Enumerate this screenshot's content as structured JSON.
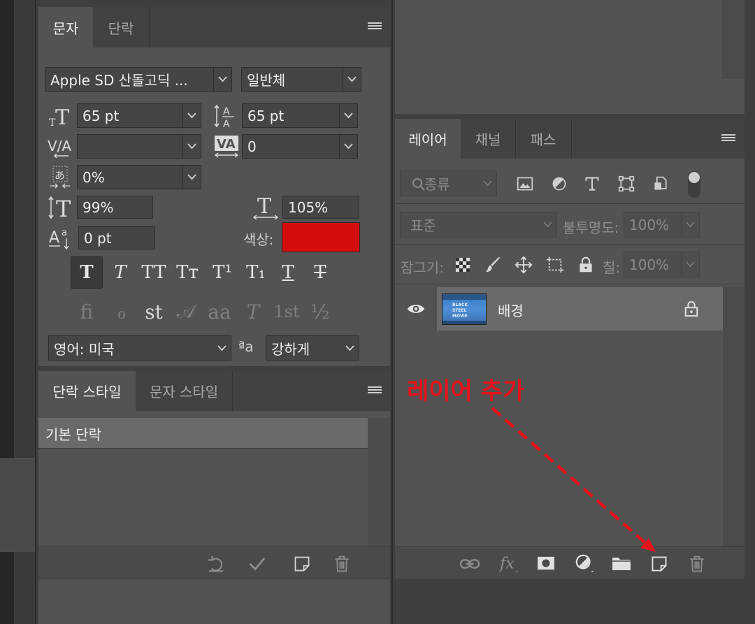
{
  "character_panel": {
    "tabs": [
      {
        "label": "문자",
        "active": true
      },
      {
        "label": "단락",
        "active": false
      }
    ],
    "font_family": "Apple SD 산돌고딕 ...",
    "font_style": "일반체",
    "font_size": "65 pt",
    "leading": "65 pt",
    "kerning": "",
    "tracking": "0",
    "tsume": "0%",
    "vertical_scale": "99%",
    "horizontal_scale": "105%",
    "baseline_shift": "0 pt",
    "color_label": "색상:",
    "color_swatch": "#d40e0e",
    "language": "영어: 미국",
    "antialias_label": "ªa",
    "antialias": "강하게",
    "style_buttons": [
      "T",
      "T",
      "TT",
      "Tт",
      "T¹",
      "T₁",
      "T",
      "T"
    ],
    "opentype_buttons": [
      "ﬁ",
      "ℴ",
      "st",
      "𝒜",
      "aa",
      "𝑇",
      "1st",
      "½"
    ]
  },
  "paragraph_styles_panel": {
    "tabs": [
      {
        "label": "단락 스타일",
        "active": true
      },
      {
        "label": "문자 스타일",
        "active": false
      }
    ],
    "items": [
      "기본 단락"
    ]
  },
  "layers_panel": {
    "tabs": [
      {
        "label": "레이어",
        "active": true
      },
      {
        "label": "채널",
        "active": false
      },
      {
        "label": "패스",
        "active": false
      }
    ],
    "filter_kind": "종류",
    "blend_mode": "표준",
    "opacity_label": "불투명도:",
    "opacity": "100%",
    "lock_label": "잠그기:",
    "fill_label": "칠:",
    "fill": "100%",
    "layers": [
      {
        "name": "배경",
        "thumbnail_text": "BLACK STEEL MOVIE"
      }
    ]
  },
  "annotation": {
    "text": "레이어 추가",
    "color": "#e8141c"
  }
}
